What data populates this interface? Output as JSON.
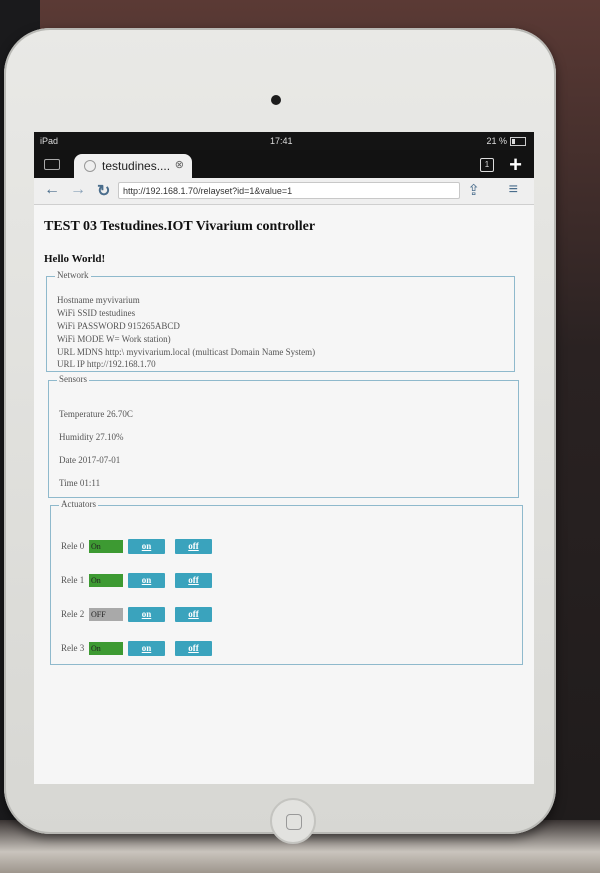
{
  "status": {
    "carrier": "iPad",
    "time": "17:41",
    "battery": "21 %"
  },
  "browser": {
    "tab_title": "testudines....",
    "tab_count": "1",
    "url": "http://192.168.1.70/relayset?id=1&value=1"
  },
  "page": {
    "title": "TEST 03 Testudines.IOT Vivarium controller",
    "greeting": "Hello World!",
    "network": {
      "legend": "Network",
      "lines": [
        "Hostname myvivarium",
        "WiFi SSID testudines",
        "WiFi PASSWORD 915265ABCD",
        "WiFi MODE W= Work station)",
        "URL MDNS http:\\ myvivarium.local (multicast Domain Name System)",
        "URL IP http://192.168.1.70"
      ]
    },
    "sensors": {
      "legend": "Sensors",
      "lines": [
        "Temperature 26.70C",
        "Humidity 27.10%",
        "Date 2017-07-01",
        "Time 01:11"
      ]
    },
    "actuators": {
      "legend": "Actuators",
      "relays": [
        {
          "label": "Rele 0",
          "state": "On",
          "on_label": "on",
          "off_label": "off",
          "state_color": "#3d9a32"
        },
        {
          "label": "Rele 1",
          "state": "On",
          "on_label": "on",
          "off_label": "off",
          "state_color": "#3d9a32"
        },
        {
          "label": "Rele 2",
          "state": "OFF",
          "on_label": "on",
          "off_label": "off",
          "state_color": "#a9a9a9"
        },
        {
          "label": "Rele 3",
          "state": "On",
          "on_label": "on",
          "off_label": "off",
          "state_color": "#3d9a32"
        }
      ]
    }
  },
  "colors": {
    "accent_button": "#3aa3bd",
    "fieldset_border": "#8fb9cc"
  }
}
